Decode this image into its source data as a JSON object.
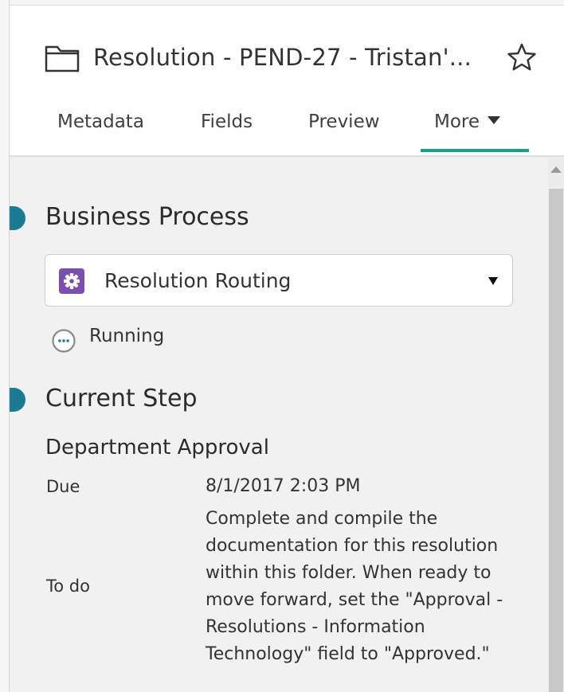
{
  "panel": {
    "title": "Resolution - PEND-27 - Tristan'...",
    "folder_icon": "folder-icon",
    "favorite_icon": "star-outline-icon"
  },
  "tabs": [
    {
      "label": "Metadata",
      "active": false
    },
    {
      "label": "Fields",
      "active": false
    },
    {
      "label": "Preview",
      "active": false
    },
    {
      "label": "More",
      "active": true,
      "icon": "caret-down-icon"
    }
  ],
  "business_process": {
    "heading": "Business Process",
    "selected": "Resolution Routing",
    "selected_icon": "gear-icon",
    "status": "Running",
    "status_icon": "ellipsis-circle-icon"
  },
  "current_step": {
    "heading": "Current Step",
    "step_name": "Department Approval",
    "due_label": "Due",
    "due_value": "8/1/2017 2:03 PM",
    "todo_label": "To do",
    "todo_value": "Complete and compile the documentation for this resolution within this folder. When ready to move forward, set the \"Approval - Resolutions - Information Technology\" field to \"Approved.\""
  },
  "colors": {
    "accent": "#17a090",
    "section_marker": "#1c7a93",
    "process_icon": "#7a4fb0",
    "content_background": "#f1f1f1"
  }
}
